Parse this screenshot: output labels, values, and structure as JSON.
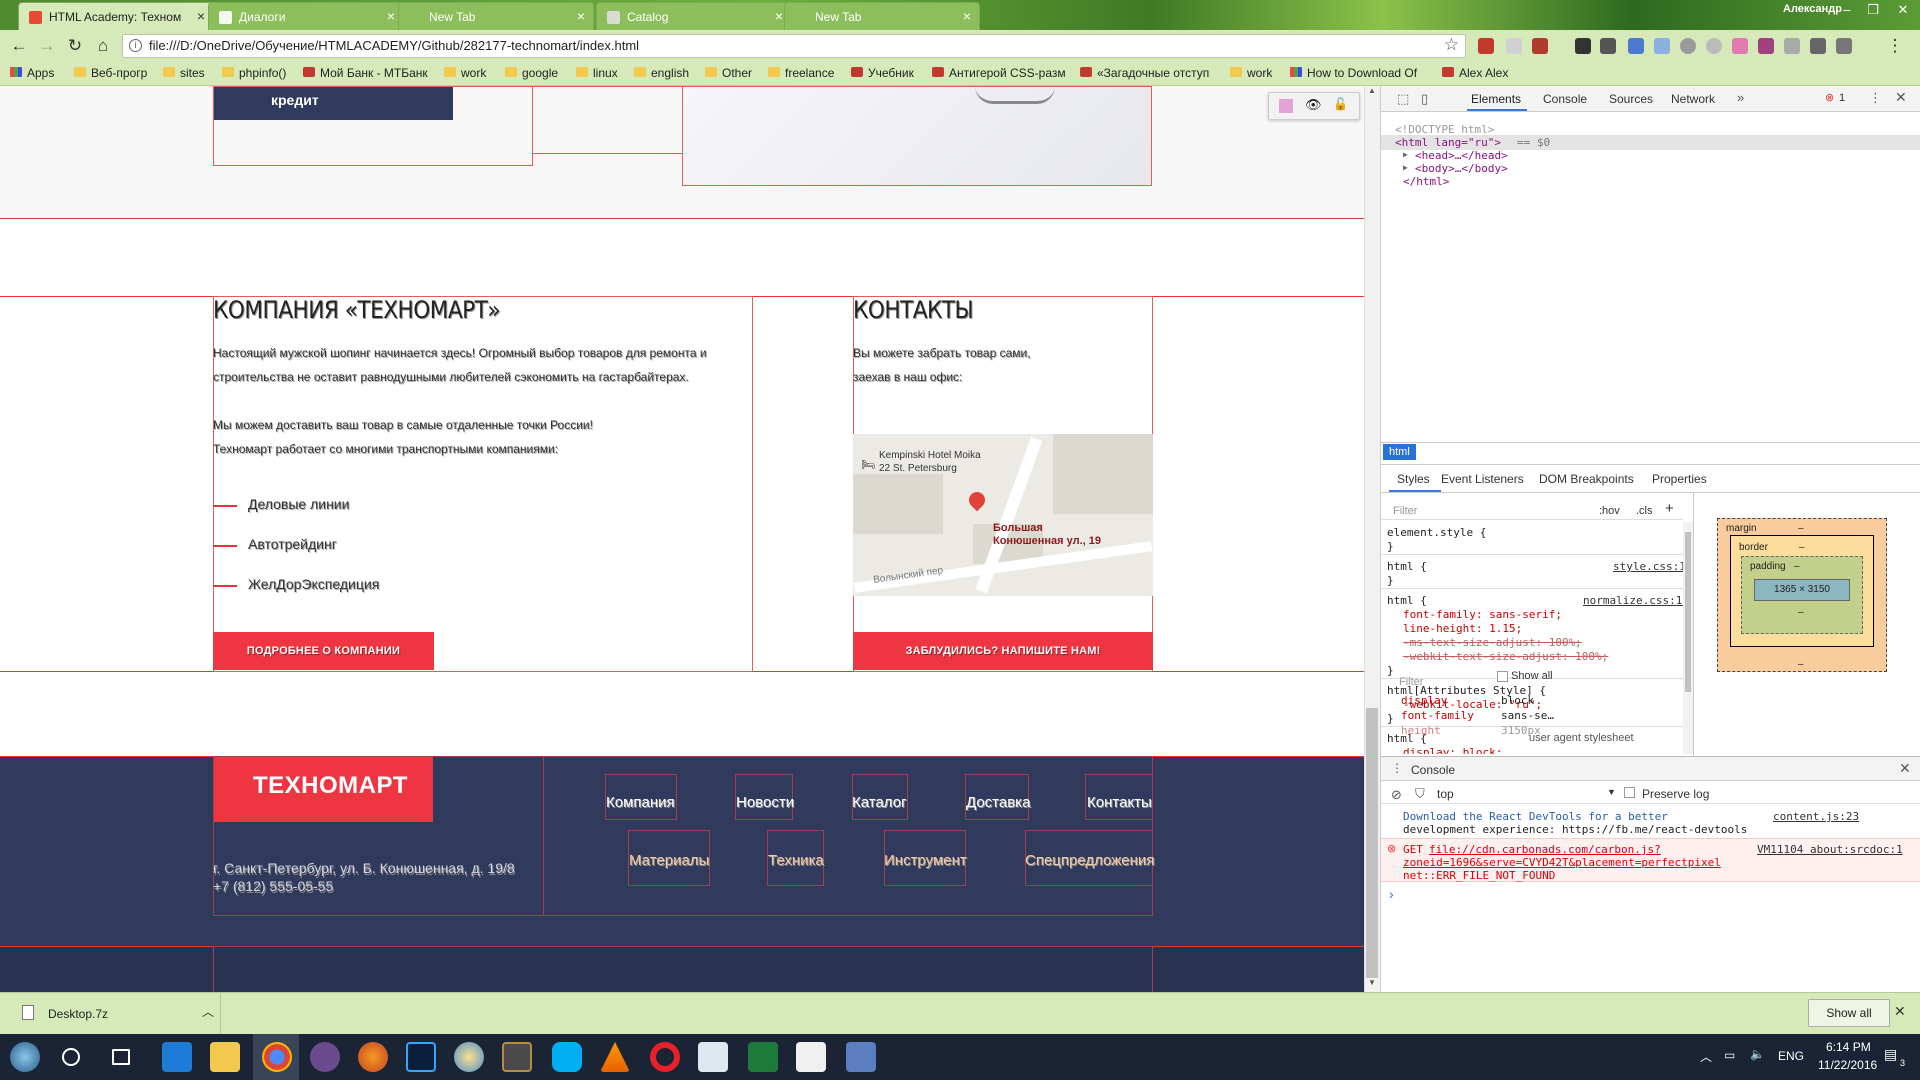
{
  "browser": {
    "tabs": [
      {
        "title": "HTML Academy: Техном",
        "active": true
      },
      {
        "title": "Диалоги",
        "active": false
      },
      {
        "title": "New Tab",
        "active": false
      },
      {
        "title": "Catalog",
        "active": false
      },
      {
        "title": "New Tab",
        "active": false
      }
    ],
    "user_name": "Александр",
    "url": "file:///D:/OneDrive/Обучение/HTMLACADEMY/Github/282177-technomart/index.html",
    "bookmarks": [
      "Apps",
      "Веб-прогр",
      "sites",
      "phpinfo()",
      "Мой Банк - МТБанк",
      "work",
      "google",
      "linux",
      "english",
      "Other",
      "freelance",
      "Учебник",
      "Антигерой CSS-разм",
      "«Загадочные отступ",
      "work",
      "How to Download Of",
      "Alex Alex"
    ]
  },
  "page": {
    "company": {
      "heading": "КОМПАНИЯ «ТЕХНОМАРТ»",
      "para1_line1": "Настоящий мужской шопинг начинается здесь! Огромный выбор товаров для ремонта и",
      "para1_line2": "строительства не оставит равнодушными любителей сэкономить на гастарбайтерах.",
      "para2_line1": "Мы можем доставить ваш товар в самые отдаленные точки России!",
      "para2_line2": "Техномарт работает со многими транспортными компаниями:",
      "partners": [
        "Деловые линии",
        "Автотрейдинг",
        "ЖелДорЭкспедиция"
      ],
      "button": "ПОДРОБНЕЕ О КОМПАНИИ"
    },
    "contacts": {
      "heading": "КОНТАКТЫ",
      "line1": "Вы можете забрать товар сами,",
      "line2": "заехав в наш офис:",
      "map_hotel_line1": "Kempinski Hotel Moika",
      "map_hotel_line2": "22 St. Petersburg",
      "map_marker_line1": "Большая",
      "map_marker_line2": "Конюшенная ул., 19",
      "map_street": "Волынский пер",
      "button": "ЗАБЛУДИЛИСЬ? НАПИШИТЕ НАМ!"
    },
    "footer": {
      "logo": "ТЕХНОМАРТ",
      "address": "г. Санкт-Петербург, ул. Б. Конюшенная, д. 19/8",
      "phone": "+7 (812) 555-05-55",
      "nav_main": [
        "Компания",
        "Новости",
        "Каталог",
        "Доставка",
        "Контакты"
      ],
      "nav_sub": [
        "Материалы",
        "Техника",
        "Инструмент",
        "Спецпредложения"
      ],
      "partial_label": "кредит"
    }
  },
  "devtools": {
    "tabs": [
      "Elements",
      "Console",
      "Sources",
      "Network"
    ],
    "error_count": "1",
    "dom": {
      "doctype": "<!DOCTYPE html>",
      "html_open": "<html lang=\"ru\">",
      "selected_marker": "== $0",
      "head": "<head>…</head>",
      "body": "<body>…</body>",
      "html_close": "</html>"
    },
    "breadcrumb": "html",
    "sub_tabs": [
      "Styles",
      "Event Listeners",
      "DOM Breakpoints",
      "Properties"
    ],
    "styles_filter": "Filter",
    "hov": ":hov",
    "cls": ".cls",
    "rules": {
      "element_style": "element.style {",
      "close": "}",
      "r1_selector": "html {",
      "r1_source": "style.css:1",
      "r2_selector": "html {",
      "r2_source": "normalize.css:13",
      "r2_p1": "font-family: sans-serif;",
      "r2_p2": "line-height: 1.15;",
      "r2_p3": "-ms-text-size-adjust: 100%;",
      "r2_p4": "-webkit-text-size-adjust: 100%;",
      "r3_selector": "html[Attributes Style] {",
      "r3_p1": "-webkit-locale: \"ru\";",
      "r4_selector": "html {",
      "r4_source": "user agent stylesheet",
      "r4_p1": "display: block;"
    },
    "box_model": {
      "margin": "margin",
      "border": "border",
      "padding": "padding",
      "dash": "–",
      "content": "1365 × 3150"
    },
    "computed": {
      "filter": "Filter",
      "show_all": "Show all",
      "rows": [
        {
          "name": "display",
          "value": "block"
        },
        {
          "name": "font-family",
          "value": "sans-se…"
        },
        {
          "name": "height",
          "value": "3150px"
        }
      ]
    },
    "console": {
      "title": "Console",
      "context": "top",
      "preserve_log": "Preserve log",
      "msg1_line1": "Download the React DevTools for a better",
      "msg1_line2": "development experience: https://fb.me/react-devtools",
      "msg1_source": "content.js:23",
      "err_prefix": "GET",
      "err_url_1": "file://cdn.carbonads.com/carbon.js?",
      "err_url_2": "zoneid=1696&serve=CVYD42T&placement=perfectpixel",
      "err_source": "VM11104 about:srcdoc:1",
      "err_line3": "net::ERR_FILE_NOT_FOUND",
      "prompt": "›"
    }
  },
  "downloads": {
    "file": "Desktop.7z",
    "show_all": "Show all"
  },
  "taskbar": {
    "lang": "ENG",
    "time": "6:14 PM",
    "date": "11/22/2016",
    "notifications": "3"
  },
  "colors": {
    "accent_red": "#ee3643",
    "footer_bg": "#2f3a5c",
    "chrome_green": "#d5eab8"
  }
}
